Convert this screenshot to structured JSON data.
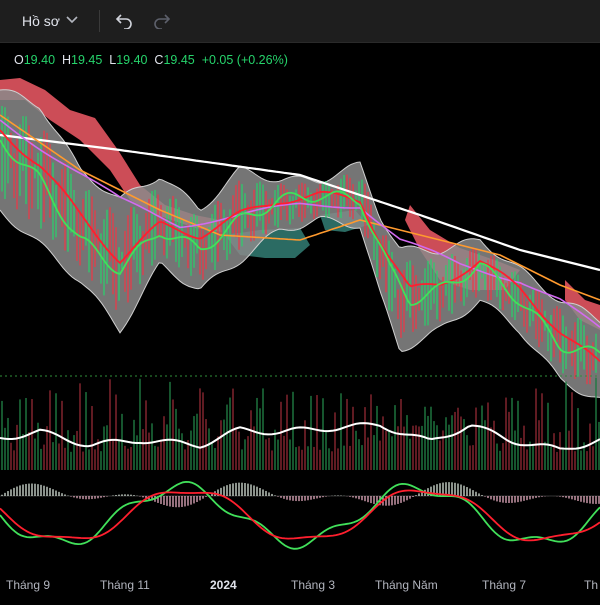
{
  "toolbar": {
    "profile_label": "Hồ sơ",
    "profile_chevron_icon": "chevron-down-icon",
    "undo_icon": "undo-icon",
    "redo_icon": "redo-icon"
  },
  "ohlc": {
    "o_label": "O",
    "o_value": "19.40",
    "h_label": "H",
    "h_value": "19.45",
    "l_label": "L",
    "l_value": "19.40",
    "c_label": "C",
    "c_value": "19.45",
    "change": "+0.05 (+0.26%)"
  },
  "colors": {
    "background": "#000000",
    "up": "#26d36b",
    "down": "#f23645",
    "band_fill": "#8a8a8a",
    "cloud_bear": "#f05a66",
    "cloud_bull": "#3a8f84",
    "ma_white": "#ffffff",
    "ma_orange": "#ff9a2e",
    "ma_violet": "#d26bf0",
    "ma_red": "#ff1f2e",
    "ma_green": "#41e05a"
  },
  "x_axis": {
    "labels": [
      "Tháng 9",
      "Tháng 11",
      "2024",
      "Tháng 3",
      "Tháng Năm",
      "Tháng 7",
      "Th"
    ]
  }
}
